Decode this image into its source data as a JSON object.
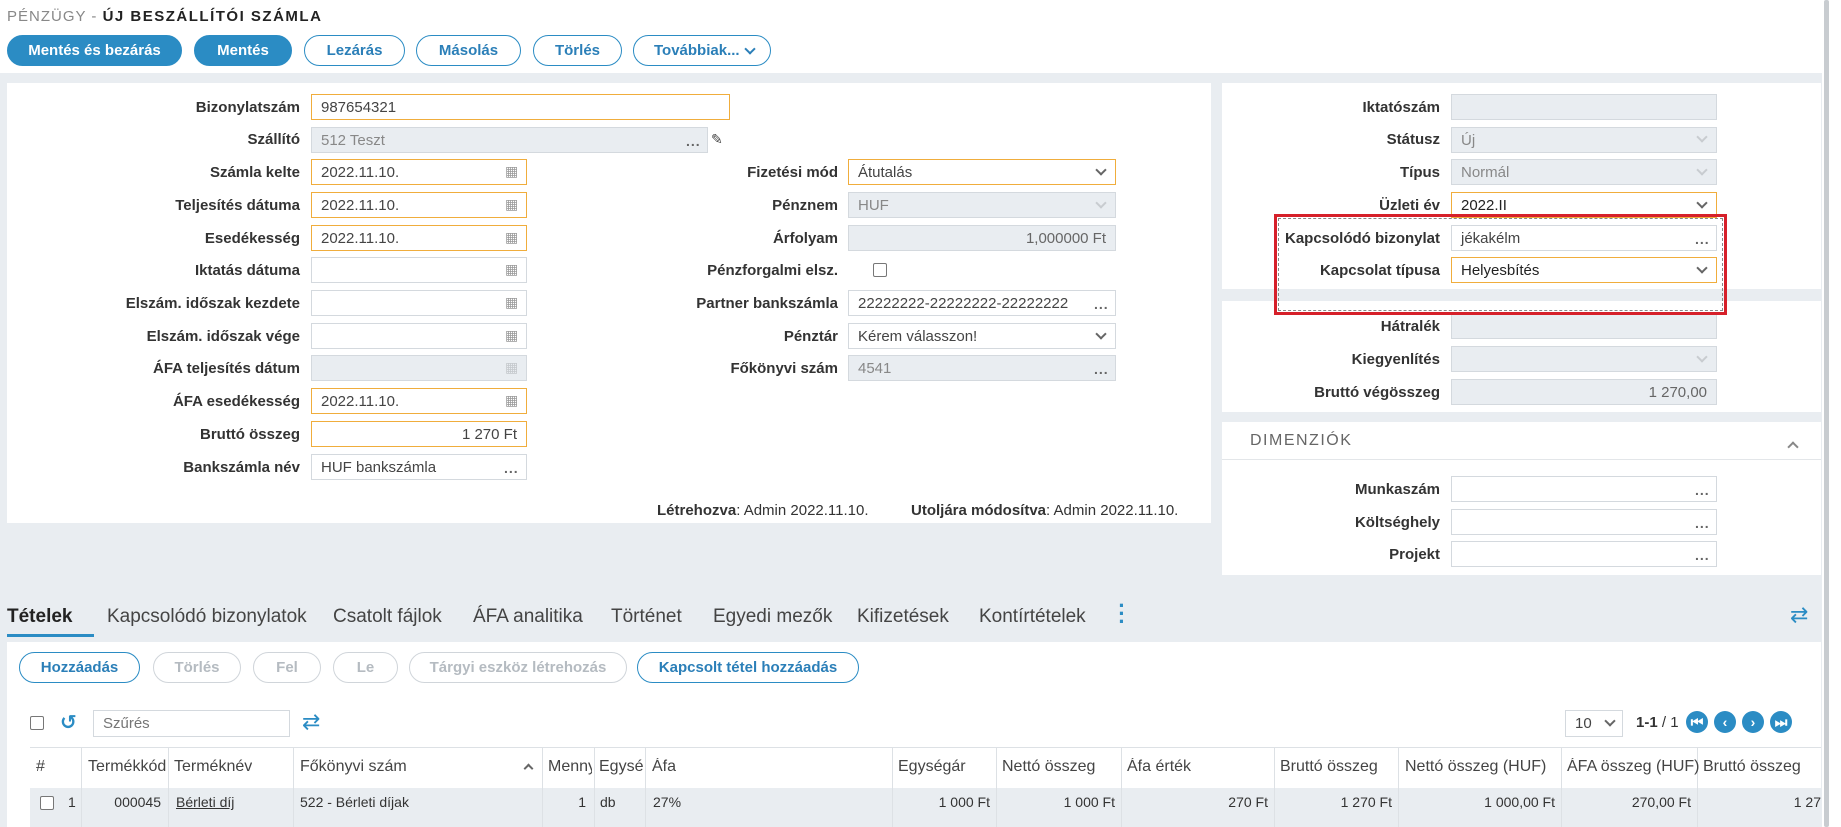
{
  "header": {
    "module": "PÉNZÜGY -",
    "title": "ÚJ BESZÁLLÍTÓI SZÁMLA"
  },
  "toolbar": {
    "save_close": "Mentés és bezárás",
    "save": "Mentés",
    "close": "Lezárás",
    "copy": "Másolás",
    "delete": "Törlés",
    "more": "Továbbiak..."
  },
  "form": {
    "invoice_number": {
      "label": "Bizonylatszám",
      "value": "987654321"
    },
    "supplier": {
      "label": "Szállító",
      "value": "512 Teszt"
    },
    "invoice_date": {
      "label": "Számla kelte",
      "value": "2022.11.10."
    },
    "fulfillment_date": {
      "label": "Teljesítés dátuma",
      "value": "2022.11.10."
    },
    "due_date": {
      "label": "Esedékesség",
      "value": "2022.11.10."
    },
    "filing_date": {
      "label": "Iktatás dátuma",
      "value": ""
    },
    "period_start": {
      "label": "Elszám. időszak kezdete",
      "value": ""
    },
    "period_end": {
      "label": "Elszám. időszak vége",
      "value": ""
    },
    "vat_fulfillment": {
      "label": "ÁFA teljesítés dátum",
      "value": ""
    },
    "vat_due": {
      "label": "ÁFA esedékesség",
      "value": "2022.11.10."
    },
    "gross_amount": {
      "label": "Bruttó összeg",
      "value": "1 270 Ft"
    },
    "bank_account_name": {
      "label": "Bankszámla név",
      "value": "HUF bankszámla"
    },
    "payment_method": {
      "label": "Fizetési mód",
      "value": "Átutalás"
    },
    "currency": {
      "label": "Pénznem",
      "value": "HUF"
    },
    "exchange_rate": {
      "label": "Árfolyam",
      "value": "1,000000 Ft"
    },
    "cash_accounting": {
      "label": "Pénzforgalmi elsz."
    },
    "partner_bank": {
      "label": "Partner bankszámla",
      "value": "22222222-22222222-22222222"
    },
    "cashbox": {
      "label": "Pénztár",
      "value": "Kérem válasszon!"
    },
    "ledger": {
      "label": "Főkönyvi szám",
      "value": "4541"
    },
    "created_label": "Létrehozva",
    "created_value": ": Admin 2022.11.10.",
    "modified_label": "Utoljára módosítva",
    "modified_value": ": Admin 2022.11.10."
  },
  "right": {
    "filing_number": {
      "label": "Iktatószám",
      "value": ""
    },
    "status": {
      "label": "Státusz",
      "value": "Új"
    },
    "type": {
      "label": "Típus",
      "value": "Normál"
    },
    "business_year": {
      "label": "Üzleti év",
      "value": "2022.II"
    },
    "related_doc": {
      "label": "Kapcsolódó bizonylat",
      "value": "jékakélm"
    },
    "relation_type": {
      "label": "Kapcsolat típusa",
      "value": "Helyesbítés"
    },
    "arrears": {
      "label": "Hátralék",
      "value": ""
    },
    "settlement": {
      "label": "Kiegyenlítés",
      "value": ""
    },
    "gross_total": {
      "label": "Bruttó végösszeg",
      "value": "1 270,00"
    }
  },
  "dimensions": {
    "title": "DIMENZIÓK",
    "work_number": "Munkaszám",
    "cost_center": "Költséghely",
    "project": "Projekt"
  },
  "tabs": [
    "Tételek",
    "Kapcsolódó bizonylatok",
    "Csatolt fájlok",
    "ÁFA analitika",
    "Történet",
    "Egyedi mezők",
    "Kifizetések",
    "Kontírtételek"
  ],
  "items_toolbar": {
    "add": "Hozzáadás",
    "delete": "Törlés",
    "up": "Fel",
    "down": "Le",
    "asset": "Tárgyi eszköz létrehozás",
    "add_linked": "Kapcsolt tétel hozzáadás"
  },
  "filter": {
    "placeholder": "Szűrés"
  },
  "pagination": {
    "page_size": "10",
    "range": "1-1",
    "total": "/ 1"
  },
  "table": {
    "columns": [
      "#",
      "Termékkód",
      "Terméknév",
      "Főkönyvi szám",
      "Menny",
      "Egység",
      "Áfa",
      "Egységár",
      "Nettó összeg",
      "Áfa érték",
      "Bruttó összeg",
      "Nettó összeg (HUF)",
      "ÁFA összeg (HUF)",
      "Bruttó összeg"
    ],
    "rows": [
      {
        "num": "1",
        "code": "000045",
        "name": "Bérleti díj",
        "ledger": "522 - Bérleti díjak",
        "qty": "1",
        "unit": "db",
        "vat": "27%",
        "unit_price": "1 000 Ft",
        "net": "1 000 Ft",
        "vat_value": "270 Ft",
        "gross": "1 270 Ft",
        "net_huf": "1 000,00 Ft",
        "vat_huf": "270,00 Ft",
        "gross_huf": "1 27"
      }
    ]
  },
  "colors": {
    "accent": "#2b8cc4",
    "required_border": "#f0ad3c",
    "highlight": "#d6202a"
  }
}
